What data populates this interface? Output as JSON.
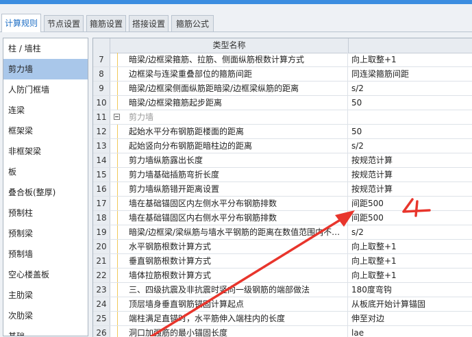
{
  "tabs": [
    "计算规则",
    "节点设置",
    "箍筋设置",
    "搭接设置",
    "箍筋公式"
  ],
  "left_items": [
    "柱 / 墙柱",
    "剪力墙",
    "人防门框墙",
    "连梁",
    "框架梁",
    "非框架梁",
    "板",
    "叠合板(整厚)",
    "预制柱",
    "预制梁",
    "预制墙",
    "空心楼盖板",
    "主肋梁",
    "次肋梁",
    "基础"
  ],
  "grid": {
    "header": "类型名称",
    "rows": [
      {
        "n": "7",
        "name": "暗梁/边框梁箍筋、拉筋、侧面纵筋根数计算方式",
        "value": "向上取整+1"
      },
      {
        "n": "8",
        "name": "边框梁与连梁重叠部位的箍筋间距",
        "value": "同连梁箍筋间距"
      },
      {
        "n": "9",
        "name": "暗梁/边框梁侧面纵筋距暗梁/边框梁纵筋的距离",
        "value": "s/2"
      },
      {
        "n": "10",
        "name": "暗梁/边框梁箍筋起步距离",
        "value": "50"
      },
      {
        "n": "11",
        "name": "剪力墙",
        "value": "",
        "group": true
      },
      {
        "n": "12",
        "name": "起始水平分布钢筋距楼面的距离",
        "value": "50"
      },
      {
        "n": "13",
        "name": "起始竖向分布钢筋距暗柱边的距离",
        "value": "s/2"
      },
      {
        "n": "14",
        "name": "剪力墙纵筋露出长度",
        "value": "按规范计算"
      },
      {
        "n": "15",
        "name": "剪力墙基础插筋弯折长度",
        "value": "按规范计算"
      },
      {
        "n": "16",
        "name": "剪力墙纵筋错开距离设置",
        "value": "按规范计算"
      },
      {
        "n": "17",
        "name": "墙在基础锚固区内左侧水平分布钢筋排数",
        "value": "间距500"
      },
      {
        "n": "18",
        "name": "墙在基础锚固区内右侧水平分布钢筋排数",
        "value": "间距500"
      },
      {
        "n": "19",
        "name": "暗梁/边框梁/梁纵筋与墙水平钢筋的距离在数值范围内不…",
        "value": "s/2"
      },
      {
        "n": "20",
        "name": "水平钢筋根数计算方式",
        "value": "向上取整+1"
      },
      {
        "n": "21",
        "name": "垂直钢筋根数计算方式",
        "value": "向上取整+1"
      },
      {
        "n": "22",
        "name": "墙体拉筋根数计算方式",
        "value": "向上取整+1"
      },
      {
        "n": "23",
        "name": "三、四级抗震及非抗震时竖向一级钢筋的端部做法",
        "value": "180度弯钩"
      },
      {
        "n": "24",
        "name": "顶层墙身垂直钢筋锚固计算起点",
        "value": "从板底开始计算锚固"
      },
      {
        "n": "25",
        "name": "端柱满足直锚时，水平筋伸入端柱内的长度",
        "value": "伸至对边"
      },
      {
        "n": "26",
        "name": "洞口加强筋的最小锚固长度",
        "value": "lae"
      }
    ]
  },
  "annotation": {
    "color": "#e8352c",
    "handwritten": "4"
  }
}
